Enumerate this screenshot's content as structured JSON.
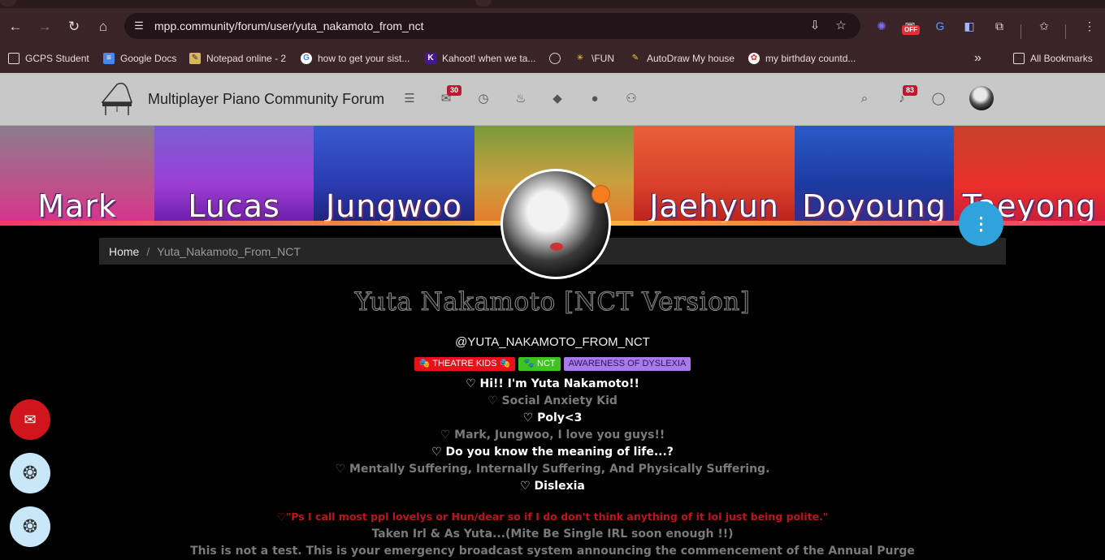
{
  "browser": {
    "url": "mpp.community/forum/user/yuta_nakamoto_from_nct",
    "extension_badge": "OFF",
    "bookmarks": [
      {
        "label": "GCPS Student",
        "icon": "folder-icon"
      },
      {
        "label": "Google Docs",
        "icon": "docs-icon"
      },
      {
        "label": "Notepad online - 2",
        "icon": "notepad-icon"
      },
      {
        "label": "how to get your sist...",
        "icon": "google-icon"
      },
      {
        "label": "Kahoot! when we ta...",
        "icon": "kahoot-icon"
      },
      {
        "label": "",
        "icon": "globe-icon"
      },
      {
        "label": "\\FUN",
        "icon": "pinwheel-icon"
      },
      {
        "label": "AutoDraw My house",
        "icon": "autodraw-icon"
      },
      {
        "label": "my birthday countd...",
        "icon": "countdown-icon"
      }
    ],
    "all_bookmarks": "All Bookmarks"
  },
  "forum": {
    "title": "Multiplayer Piano Community Forum",
    "unread_count": "30",
    "notification_count": "83"
  },
  "cover_names": [
    "Mark",
    "Lucas",
    "Jungwoo",
    "",
    "Jaehyun",
    "Doyoung",
    "Taeyong"
  ],
  "breadcrumb": {
    "home": "Home",
    "separator": "/",
    "current": "Yuta_Nakamoto_From_NCT"
  },
  "profile": {
    "fullname": "Yuta Nakamoto [NCT Version]",
    "username": "@YUTA_NAKAMOTO_FROM_NCT",
    "groups": [
      {
        "label": "🎭 THEATRE KIDS 🎭",
        "bg": "#e8101a",
        "fg": "#ffffff"
      },
      {
        "label": "🐾 NCT",
        "bg": "#3ec41e",
        "fg": "#ffffff"
      },
      {
        "label": "AWARENESS OF DYSLEXIA",
        "bg": "#a97be8",
        "fg": "#2b1466"
      }
    ],
    "bio": [
      {
        "text": "♡ Hi!! I'm Yuta Nakamoto!!",
        "color": "#ffffff"
      },
      {
        "text": "♡ Social Anxiety Kid",
        "color": "#7a7a7a"
      },
      {
        "text": "♡ Poly<3",
        "color": "#ffffff"
      },
      {
        "text": "♡ Mark, Jungwoo, I love you guys!!",
        "color": "#7a7a7a"
      },
      {
        "text": "♡ Do you know the meaning of life...?",
        "color": "#ffffff"
      },
      {
        "text": "♡ Mentally Suffering, Internally Suffering, And Physically Suffering.",
        "color": "#7a7a7a"
      },
      {
        "text": "♡ Dislexia",
        "color": "#ffffff"
      },
      {
        "text": "♡\"Ps I call most ppl lovelys or Hun/dear so if I do don't think anything of it lol just being polite.\"",
        "color": "#c0141c"
      },
      {
        "text": "Taken Irl & As Yuta...(Mite Be Single IRL soon enough !!)",
        "color": "#7a7a7a"
      },
      {
        "text": "This is not a test. This is your emergency broadcast system announcing the commencement of the Annual Purge",
        "color": "#7a7a7a"
      }
    ]
  },
  "colors": {
    "fab_menu": "#2ea3dc",
    "chat_button": "#d0151d",
    "status_dot": "#f57c1f"
  }
}
